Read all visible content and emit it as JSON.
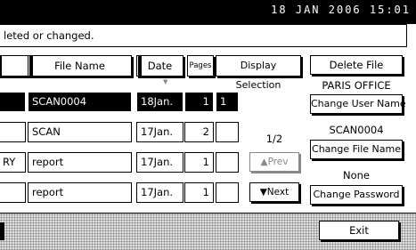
{
  "status": {
    "datetime": "18 JAN  2006 15:01"
  },
  "message": "leted or changed.",
  "table": {
    "headers": {
      "file_name": "File Name",
      "date": "Date",
      "pages": "Pages",
      "display_selection": "Display Selection"
    },
    "rows": [
      {
        "user": "",
        "file_name": "SCAN0004",
        "date": "18Jan.",
        "pages": "1",
        "selection": "1",
        "selected": true
      },
      {
        "user": "",
        "file_name": "SCAN",
        "date": "17Jan.",
        "pages": "2",
        "selection": "",
        "selected": false
      },
      {
        "user": "RY",
        "file_name": "report",
        "date": "17Jan.",
        "pages": "1",
        "selection": "",
        "selected": false
      },
      {
        "user": "",
        "file_name": "report",
        "date": "17Jan.",
        "pages": "1",
        "selection": "",
        "selected": false
      }
    ]
  },
  "pager": {
    "page": "1/2",
    "prev_label": "▲Prev",
    "next_label": "▼Next"
  },
  "side": {
    "delete_file": "Delete File",
    "user_name": "PARIS OFFICE",
    "change_user_name": "Change User Name",
    "file_name": "SCAN0004",
    "change_file_name": "Change File Name",
    "password": "None",
    "change_password": "Change Password"
  },
  "exit_label": "Exit"
}
